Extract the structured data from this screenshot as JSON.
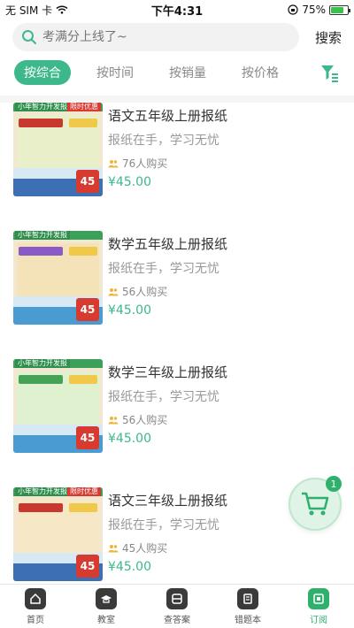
{
  "status_bar": {
    "carrier": "无 SIM 卡",
    "time": "下午4:31",
    "battery": "75%",
    "battery_level": 0.75
  },
  "search": {
    "placeholder": "考满分上线了~",
    "button": "搜索"
  },
  "filters": {
    "tabs": [
      "按综合",
      "按时间",
      "按销量",
      "按价格"
    ],
    "active_index": 0
  },
  "products": [
    {
      "title": "语文五年级上册报纸",
      "subtitle": "报纸在手，学习无忧",
      "buyers": "76人购买",
      "price": "¥45.00",
      "cover": {
        "top_label": "小年智力开发报",
        "promo": "限时优惠",
        "badge": "45"
      }
    },
    {
      "title": "数学五年级上册报纸",
      "subtitle": "报纸在手，学习无忧",
      "buyers": "56人购买",
      "price": "¥45.00",
      "cover": {
        "top_label": "小年智力开发报",
        "promo": "",
        "badge": "45"
      }
    },
    {
      "title": "数学三年级上册报纸",
      "subtitle": "报纸在手，学习无忧",
      "buyers": "56人购买",
      "price": "¥45.00",
      "cover": {
        "top_label": "小年智力开发报",
        "promo": "",
        "badge": "45"
      }
    },
    {
      "title": "语文三年级上册报纸",
      "subtitle": "报纸在手，学习无忧",
      "buyers": "45人购买",
      "price": "¥45.00",
      "cover": {
        "top_label": "小年智力开发报",
        "promo": "限时优惠",
        "badge": "45"
      }
    }
  ],
  "cart": {
    "count": "1"
  },
  "tabbar": [
    {
      "label": "首页",
      "icon": "home-icon"
    },
    {
      "label": "教室",
      "icon": "classroom-icon"
    },
    {
      "label": "查答案",
      "icon": "answers-icon"
    },
    {
      "label": "错题本",
      "icon": "mistakes-icon"
    },
    {
      "label": "订阅",
      "icon": "subscribe-icon"
    }
  ],
  "colors": {
    "accent": "#3db88b",
    "price": "#3db88b"
  }
}
